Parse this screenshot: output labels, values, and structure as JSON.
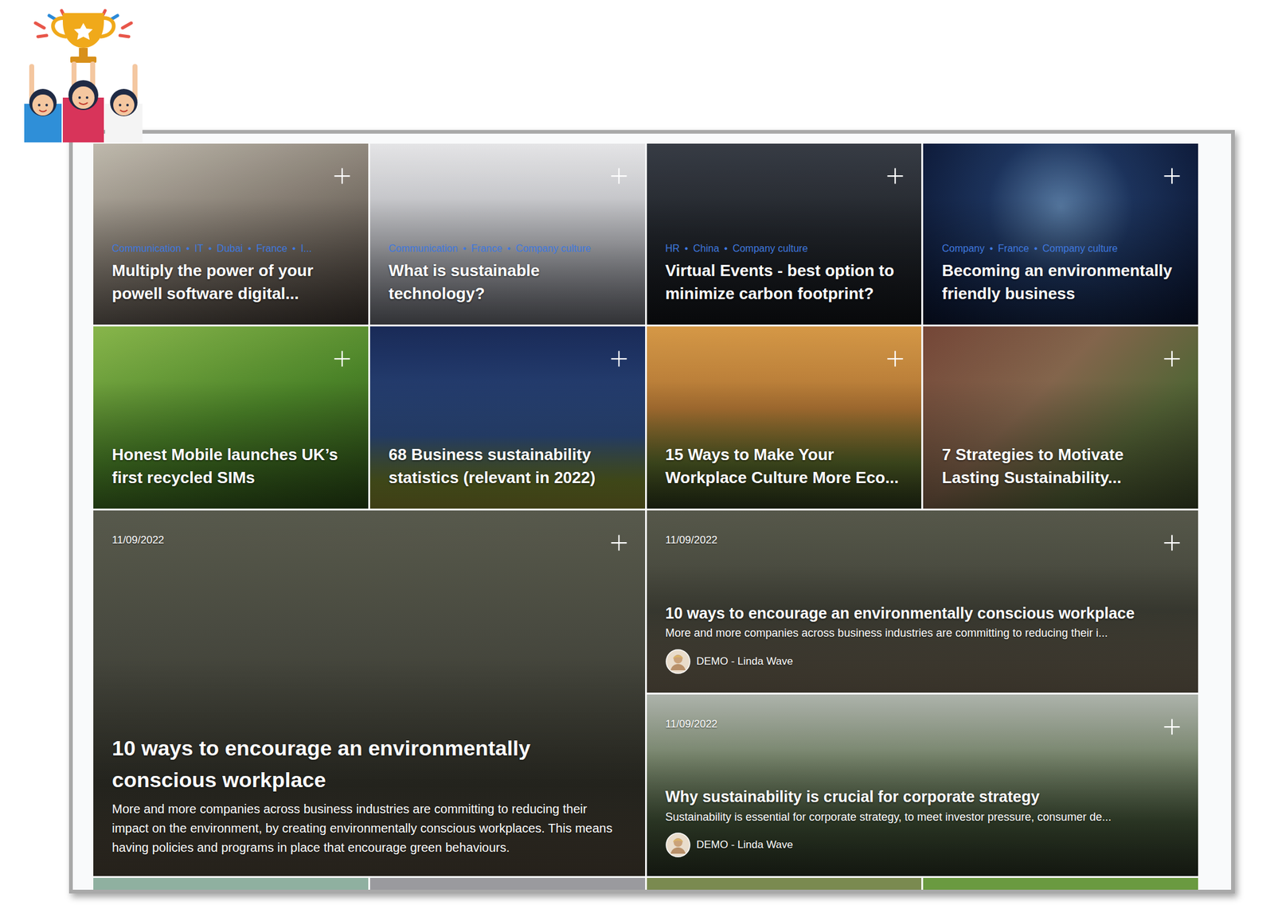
{
  "tag_separator": "•",
  "tiles": [
    {
      "tags": [
        "Communication",
        "IT",
        "Dubai",
        "France",
        "I..."
      ],
      "title": "Multiply the power of your powell software digital..."
    },
    {
      "tags": [
        "Communication",
        "France",
        "Company culture"
      ],
      "title": "What is sustainable technology?"
    },
    {
      "tags": [
        "HR",
        "China",
        "Company culture"
      ],
      "title": "Virtual Events - best option to minimize carbon footprint?"
    },
    {
      "tags": [
        "Company",
        "France",
        "Company culture"
      ],
      "title": "Becoming an environmentally friendly business"
    },
    {
      "tags": [],
      "title": "Honest Mobile launches UK’s first recycled SIMs"
    },
    {
      "tags": [],
      "title": "68 Business sustainability statistics (relevant in 2022)"
    },
    {
      "tags": [],
      "title": "15 Ways to Make Your Workplace Culture More Eco..."
    },
    {
      "tags": [],
      "title": "7 Strategies to Motivate Lasting Sustainability..."
    }
  ],
  "featured": {
    "date": "11/09/2022",
    "title": "10 ways to encourage an environmentally conscious workplace",
    "description": "More and more companies across business industries are committing to reducing their impact on the environment, by creating environmentally conscious workplaces. This means having policies and programs in place that encourage green behaviours."
  },
  "side_posts": [
    {
      "date": "11/09/2022",
      "title": "10 ways to encourage an environmentally conscious workplace",
      "description": "More and more companies across business industries are committing to reducing their i...",
      "author": "DEMO - Linda Wave"
    },
    {
      "date": "11/09/2022",
      "title": "Why sustainability is crucial for corporate strategy",
      "description": "Sustainability is essential for corporate strategy, to meet investor pressure, consumer de...",
      "author": "DEMO - Linda Wave"
    }
  ]
}
